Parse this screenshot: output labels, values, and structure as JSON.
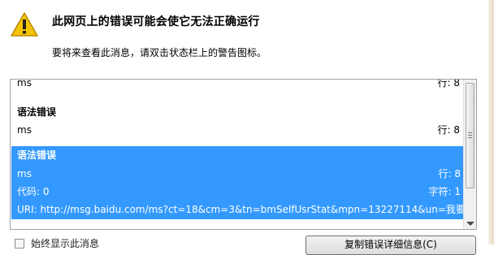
{
  "header": {
    "title": "此网页上的错误可能会使它无法正确运行",
    "subtitle": "要将来查看此消息，请双击状态栏上的警告图标。"
  },
  "errors": {
    "item_top": {
      "message": "ms",
      "line": "行: 8"
    },
    "item_second": {
      "type": "语法错误",
      "message": "ms",
      "line": "行: 8"
    },
    "selected": {
      "type": "语法错误",
      "message": "ms",
      "line": "行: 8",
      "code": "代码: 0",
      "char": "字符: 1",
      "uri": "URI: http://msg.baidu.com/ms?ct=18&cm=3&tn=bmSelfUsrStat&mpn=13227114&un=我要..."
    }
  },
  "footer": {
    "checkbox_label": "始终显示此消息",
    "copy_button": "复制错误详细信息(C)"
  },
  "icons": {
    "warning": "warning-triangle-icon"
  },
  "colors": {
    "selection": "#3399ff",
    "warning_fill": "#f5c400"
  }
}
